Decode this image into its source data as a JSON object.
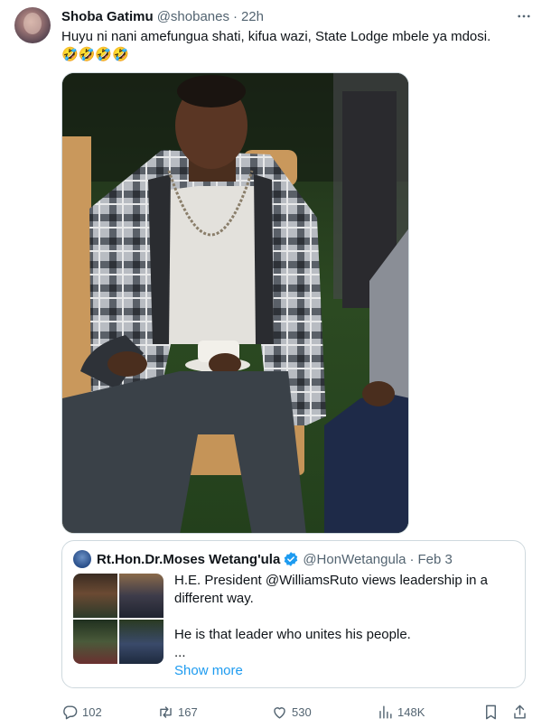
{
  "tweet": {
    "display_name": "Shoba Gatimu",
    "handle": "@shobanes",
    "separator": "·",
    "time": "22h",
    "text": "Huyu ni nani amefungua shati, kifua wazi, State Lodge mbele ya mdosi.",
    "emojis": "🤣🤣🤣🤣"
  },
  "quote": {
    "display_name": "Rt.Hon.Dr.Moses Wetang'ula",
    "handle": "@HonWetangula",
    "separator": "·",
    "date": "Feb 3",
    "line1": "H.E. President @WilliamsRuto views leadership in a different way.",
    "line2": "He is that leader who unites his people.",
    "ellipsis": "...",
    "show_more": "Show more"
  },
  "actions": {
    "replies": "102",
    "retweets": "167",
    "likes": "530",
    "views": "148K"
  },
  "icons": {
    "more": "more-horizontal-icon",
    "verified": "verified-badge-icon",
    "reply": "reply-icon",
    "retweet": "retweet-icon",
    "like": "heart-icon",
    "views": "views-bar-chart-icon",
    "bookmark": "bookmark-icon",
    "share": "share-icon"
  },
  "colors": {
    "text": "#0f1419",
    "secondary": "#536471",
    "accent": "#1d9bf0",
    "border": "#cfd9de"
  }
}
